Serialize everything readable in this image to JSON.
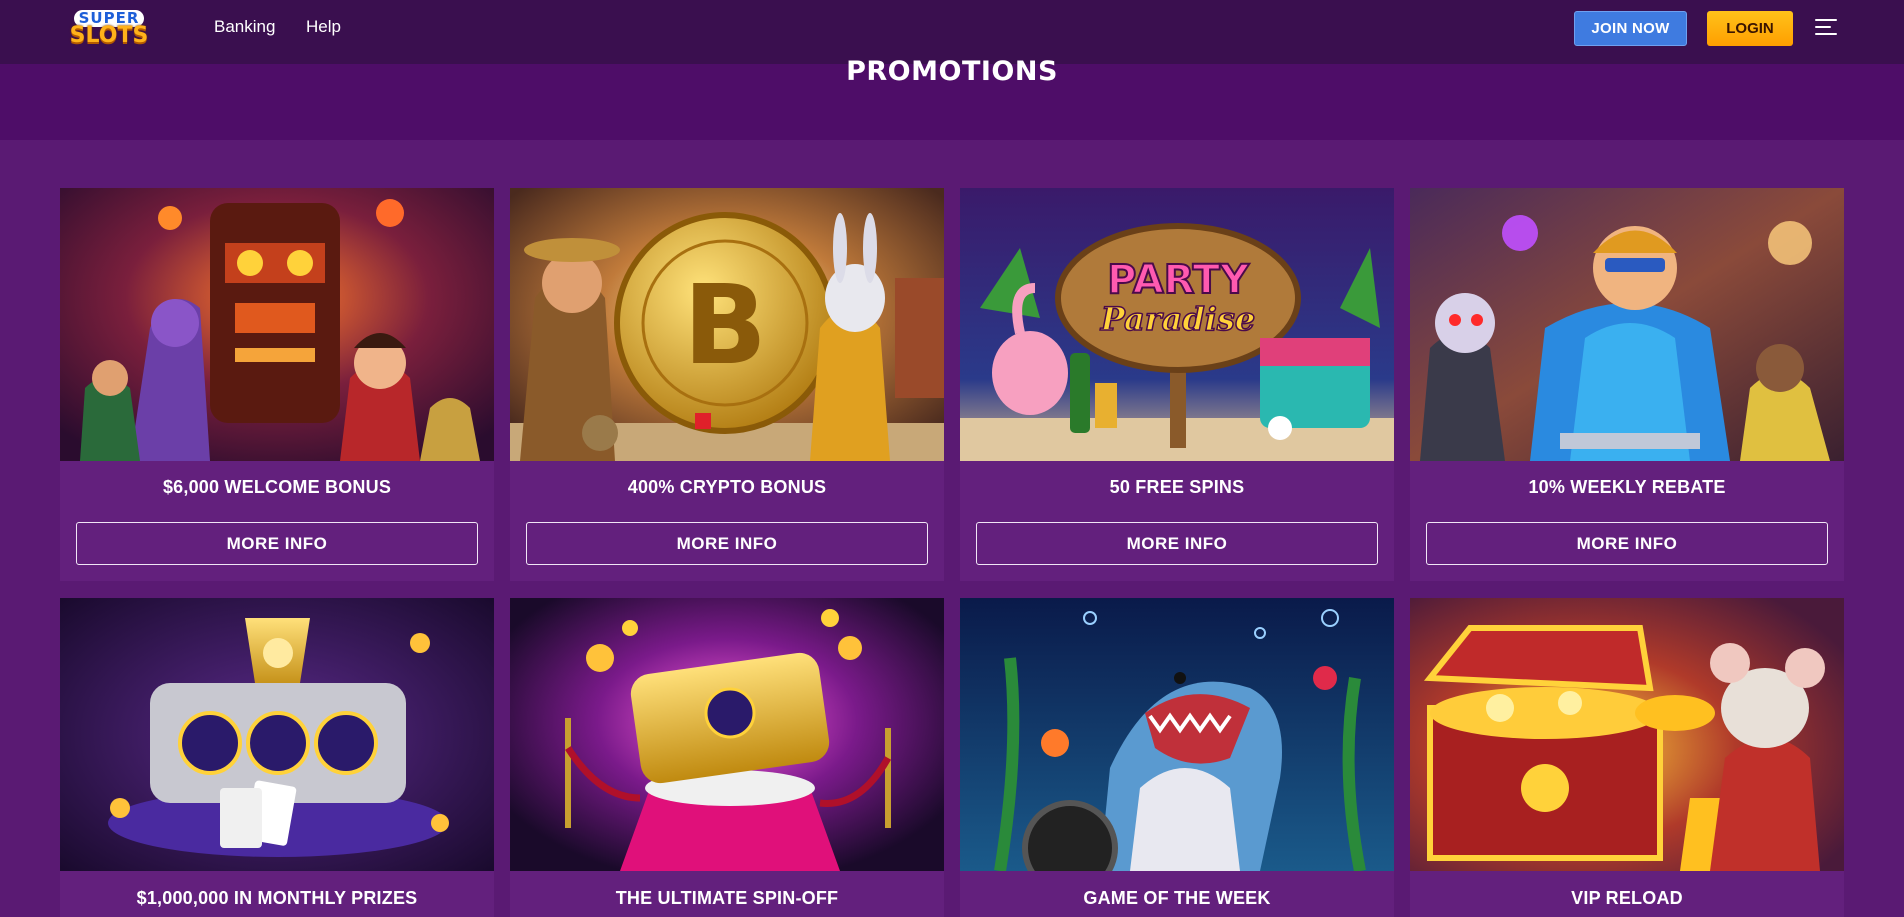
{
  "header": {
    "logo_top": "SUPER",
    "logo_bottom": "SLOTS",
    "nav": [
      "Banking",
      "Help"
    ],
    "join_label": "JOIN NOW",
    "login_label": "LOGIN"
  },
  "page": {
    "title": "PROMOTIONS"
  },
  "promos": [
    {
      "title": "$6,000 WELCOME BONUS",
      "button": "MORE INFO"
    },
    {
      "title": "400% CRYPTO BONUS",
      "button": "MORE INFO"
    },
    {
      "title": "50 FREE SPINS",
      "button": "MORE INFO"
    },
    {
      "title": "10% WEEKLY REBATE",
      "button": "MORE INFO"
    },
    {
      "title": "$1,000,000 IN MONTHLY PRIZES"
    },
    {
      "title": "THE ULTIMATE SPIN-OFF"
    },
    {
      "title": "GAME OF THE WEEK"
    },
    {
      "title": "VIP RELOAD"
    }
  ],
  "art_text": {
    "bitcoin": "B",
    "party_1": "PARTY",
    "party_2": "Paradise"
  },
  "colors": {
    "background": "#5a1a73",
    "header": "#3a0f4f",
    "card": "#63207d",
    "join": "#3f7be0",
    "login": "#ffa400"
  }
}
